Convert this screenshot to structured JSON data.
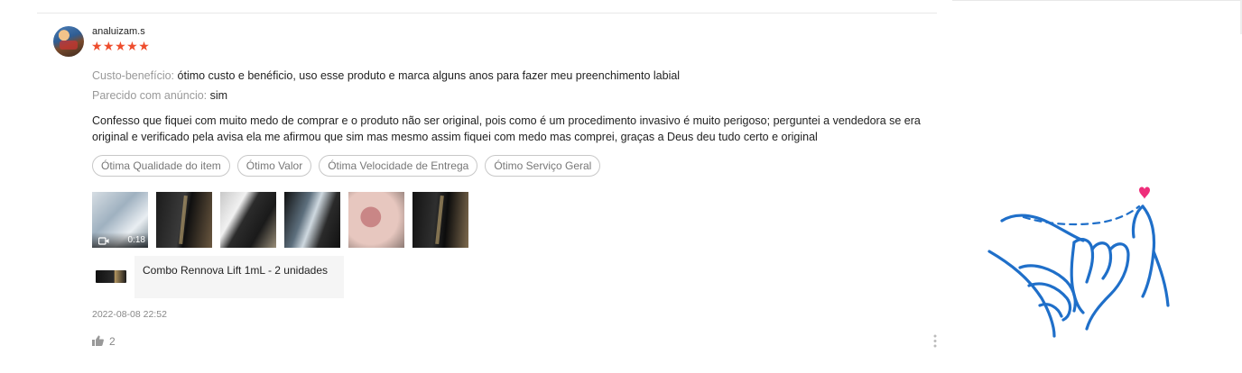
{
  "review": {
    "username": "analuizam.s",
    "rating": "★★★★★",
    "attributes": [
      {
        "label": "Custo-benefício:",
        "value": "ótimo custo e benéficio, uso esse produto e marca alguns anos para fazer meu preenchimento labial"
      },
      {
        "label": "Parecido com anúncio:",
        "value": "sim"
      }
    ],
    "comment": "Confesso que fiquei com muito medo de comprar e o produto não ser original, pois como é um procedimento invasivo é muito perigoso; perguntei a vendedora se era original e verificado pela avisa ela me afirmou que sim mas mesmo assim fiquei com medo mas comprei, graças a Deus deu tudo certo e original",
    "tags": [
      "Ótima Qualidade do item",
      "Ótimo Valor",
      "Ótima Velocidade de Entrega",
      "Ótimo Serviço Geral"
    ],
    "video_duration": "0:18",
    "product_variation": "Combo Rennova Lift 1mL - 2 unidades",
    "timestamp": "2022-08-08 22:52",
    "likes": "2"
  },
  "colors": {
    "star": "#ee4d2d",
    "label_gray": "#999999",
    "illustration_blue": "#1f6fc9",
    "heart_pink": "#ee2d7a"
  },
  "icons": {
    "like": "thumbs-up-icon",
    "more": "vertical-dots-icon",
    "video": "video-camera-icon"
  }
}
